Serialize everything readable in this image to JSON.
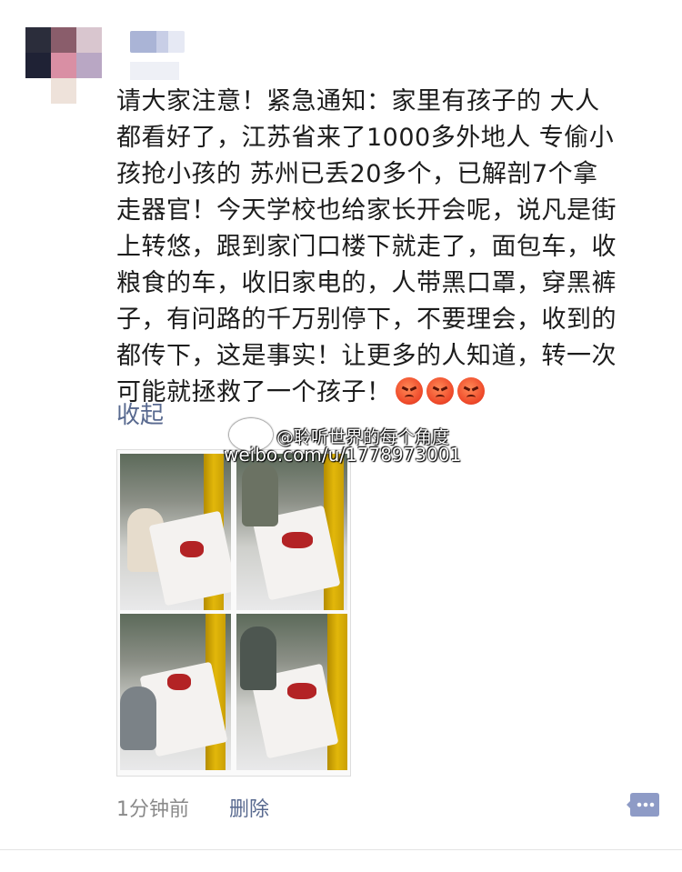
{
  "post": {
    "text": "请大家注意！紧急通知：家里有孩子的 大人\n都看好了，江苏省来了1000多外地人 专偷小\n孩抢小孩的 苏州已丢20多个，已解剖7个拿\n走器官！今天学校也给家长开会呢，说凡是街\n上转悠，跟到家门口楼下就走了，面包车，收\n粮食的车，收旧家电的，人带黑口罩，穿黑裤\n子，有问路的千万别停下，不要理会，收到的\n都传下，这是事实！让更多的人知道，转一次\n可能就拯救了一个孩子！",
    "emojis": [
      "angry-face",
      "angry-face",
      "angry-face"
    ],
    "collapse_label": "收起",
    "time": "1分钟前",
    "delete_label": "删除"
  },
  "watermark": {
    "line1": "@聆听世界的每个角度",
    "line2": "weibo.com/u/1778973001"
  },
  "colors": {
    "link": "#58698f",
    "text": "#1c1c1c",
    "meta": "#8a8a8a",
    "comment_icon": "#8e9bc6"
  }
}
